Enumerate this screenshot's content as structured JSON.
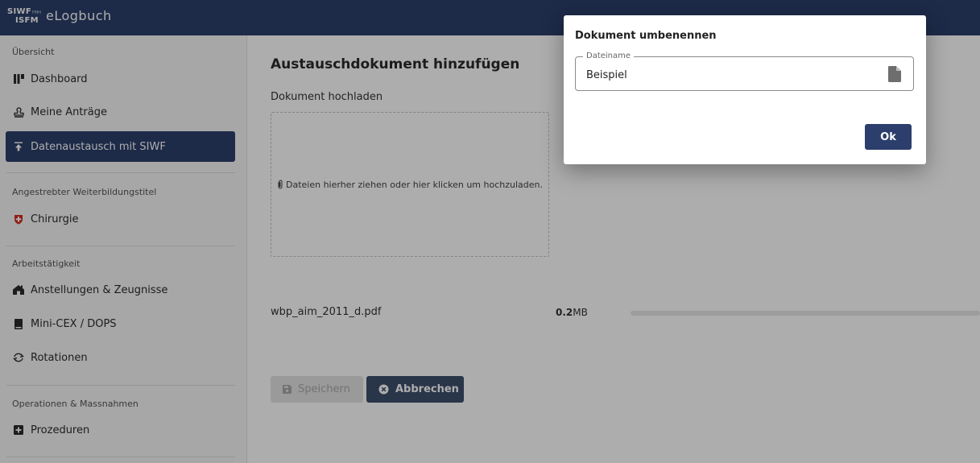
{
  "header": {
    "logo_line1": "SIWF",
    "logo_line2": "ISFM",
    "logo_small": "FMH",
    "app_title": "eLogbuch"
  },
  "sidebar": {
    "sections": {
      "overview": "Übersicht",
      "title": "Angestrebter Weiterbildungstitel",
      "work": "Arbeitstätigkeit",
      "operations": "Operationen & Massnahmen"
    },
    "items": [
      {
        "label": "Dashboard",
        "icon": "dashboard-icon"
      },
      {
        "label": "Meine Anträge",
        "icon": "stamp-icon"
      },
      {
        "label": "Datenaustausch mit SIWF",
        "icon": "upload-icon",
        "active": true
      },
      {
        "label": "Chirurgie",
        "icon": "swiss-cross-icon"
      },
      {
        "label": "Anstellungen & Zeugnisse",
        "icon": "home-icon"
      },
      {
        "label": "Mini-CEX / DOPS",
        "icon": "book-icon"
      },
      {
        "label": "Rotationen",
        "icon": "rotate-icon"
      },
      {
        "label": "Prozeduren",
        "icon": "plus-square-icon"
      }
    ]
  },
  "main": {
    "title": "Austauschdokument hinzufügen",
    "upload_label": "Dokument hochladen",
    "dropzone_text": "Dateien hierher ziehen oder hier klicken um hochzuladen.",
    "file": {
      "name": "wbp_aim_2011_d.pdf",
      "size_value": "0.2",
      "size_unit": "MB",
      "progress": 0
    },
    "buttons": {
      "save": "Speichern",
      "cancel": "Abbrechen"
    }
  },
  "dialog": {
    "title": "Dokument umbenennen",
    "field_label": "Dateiname",
    "field_value": "Beispiel",
    "ok": "Ok"
  },
  "colors": {
    "primary": "#2c3e6b",
    "cancel_button": "#3d4e6c",
    "swiss_red": "#d52b1e"
  }
}
